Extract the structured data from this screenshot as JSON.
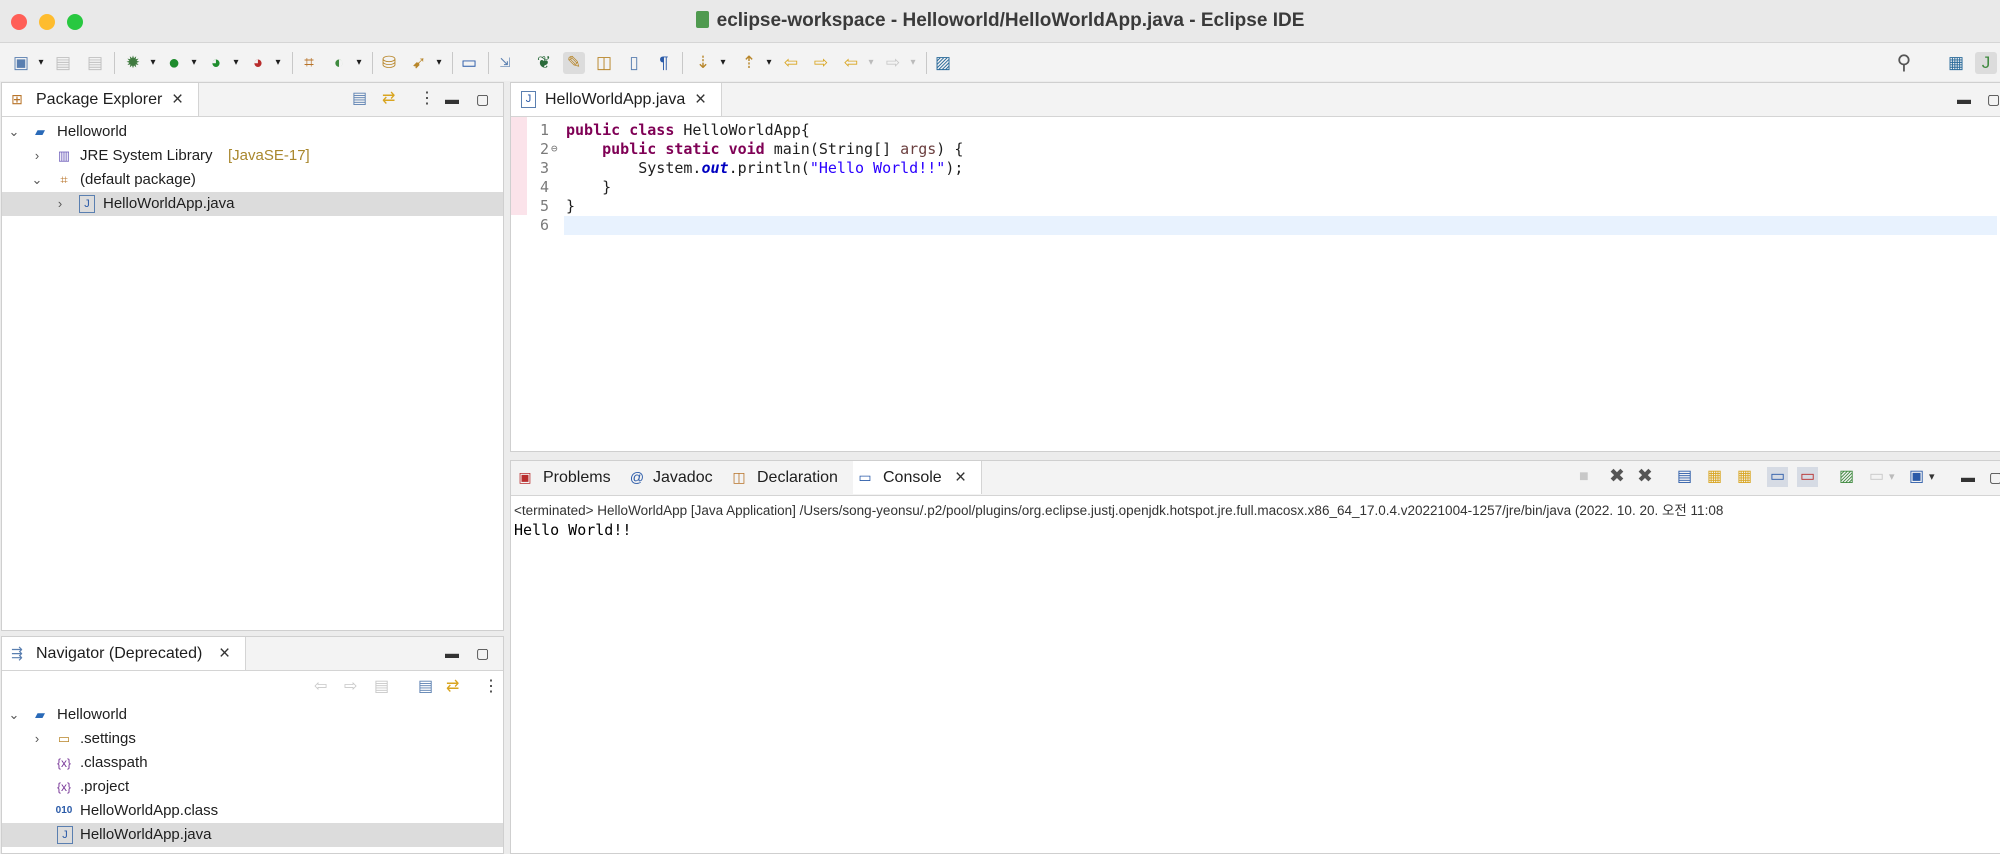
{
  "window": {
    "title": "eclipse-workspace - Helloworld/HelloWorldApp.java - Eclipse IDE",
    "traffic_lights": [
      "#ff5f57",
      "#febc2e",
      "#28c840"
    ]
  },
  "package_explorer": {
    "title": "Package Explorer",
    "tree": [
      {
        "label": "Helloworld",
        "decoration": "",
        "icon": "project-icon"
      },
      {
        "label": "JRE System Library",
        "decoration": "[JavaSE-17]",
        "icon": "library-icon"
      },
      {
        "label": "(default package)",
        "decoration": "",
        "icon": "package-icon"
      },
      {
        "label": "HelloWorldApp.java",
        "decoration": "",
        "icon": "java-file-icon"
      }
    ]
  },
  "navigator": {
    "title": "Navigator (Deprecated)",
    "tree": [
      {
        "label": "Helloworld",
        "icon": "project-icon"
      },
      {
        "label": ".settings",
        "icon": "folder-icon"
      },
      {
        "label": ".classpath",
        "icon": "xml-file-icon"
      },
      {
        "label": ".project",
        "icon": "xml-file-icon"
      },
      {
        "label": "HelloWorldApp.class",
        "icon": "class-file-icon"
      },
      {
        "label": "HelloWorldApp.java",
        "icon": "java-file-icon"
      }
    ]
  },
  "editor": {
    "tab": "HelloWorldApp.java",
    "line_numbers": [
      "1",
      "2",
      "3",
      "4",
      "5",
      "6"
    ],
    "lines": [
      "public class HelloWorldApp{",
      "    public static void main(String[] args) {",
      "        System.out.println(\"Hello World!!\");",
      "    }",
      "}",
      ""
    ]
  },
  "bottom_panel": {
    "tabs": [
      "Problems",
      "Javadoc",
      "Declaration",
      "Console"
    ],
    "active_tab": "Console",
    "console": {
      "terminated": "<terminated> HelloWorldApp [Java Application] /Users/song-yeonsu/.p2/pool/plugins/org.eclipse.justj.openjdk.hotspot.jre.full.macosx.x86_64_17.0.4.v20221004-1257/jre/bin/java  (2022. 10. 20. 오전 11:08",
      "output": "Hello World!!"
    }
  }
}
